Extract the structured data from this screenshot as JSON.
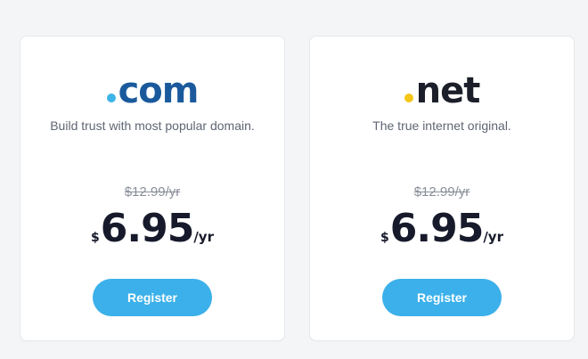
{
  "cards": [
    {
      "logo": {
        "text": "com",
        "dot_color": "#3db4e8",
        "text_color": "#1a5a9c"
      },
      "tagline": "Build trust with most popular domain.",
      "old_price": "$12.99/yr",
      "price": {
        "currency": "$",
        "amount": "6.95",
        "period": "/yr"
      },
      "button_label": "Register"
    },
    {
      "logo": {
        "text": "net",
        "dot_color": "#f5c518",
        "text_color": "#1c1f2a"
      },
      "tagline": "The true internet original.",
      "old_price": "$12.99/yr",
      "price": {
        "currency": "$",
        "amount": "6.95",
        "period": "/yr"
      },
      "button_label": "Register"
    }
  ],
  "colors": {
    "accent": "#3bb0ea",
    "page_background": "#f4f5f7"
  }
}
